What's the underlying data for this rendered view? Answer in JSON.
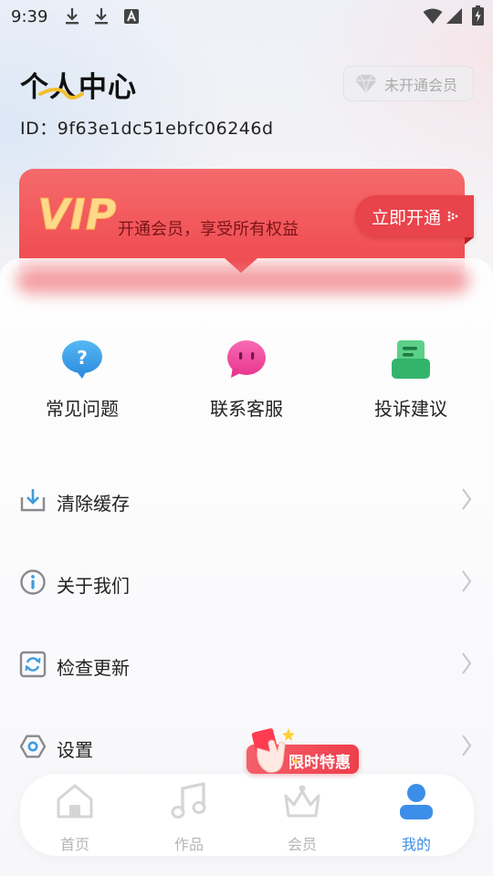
{
  "status_bar": {
    "time": "9:39"
  },
  "header": {
    "title": "个人中心",
    "user_id": "ID：9f63e1dc51ebfc06246d",
    "member_status": "未开通会员"
  },
  "vip": {
    "logo": "VIP",
    "description": "开通会员，享受所有权益",
    "cta": "立即开通"
  },
  "quick_actions": [
    {
      "label": "常见问题",
      "icon": "question-chat-icon"
    },
    {
      "label": "联系客服",
      "icon": "customer-service-icon"
    },
    {
      "label": "投诉建议",
      "icon": "feedback-box-icon"
    }
  ],
  "menu": [
    {
      "label": "清除缓存",
      "icon": "download-tray-icon"
    },
    {
      "label": "关于我们",
      "icon": "info-icon"
    },
    {
      "label": "检查更新",
      "icon": "refresh-icon"
    },
    {
      "label": "设置",
      "icon": "settings-icon"
    }
  ],
  "promo": {
    "label": "限时特惠"
  },
  "nav": [
    {
      "label": "首页",
      "icon": "home-icon"
    },
    {
      "label": "作品",
      "icon": "music-note-icon"
    },
    {
      "label": "会员",
      "icon": "crown-icon"
    },
    {
      "label": "我的",
      "icon": "user-icon",
      "active": true
    }
  ],
  "colors": {
    "vip_red": "#ef4a4f",
    "vip_gold": "#ffd98a",
    "nav_active": "#3d8ee8",
    "nav_inactive": "#b5b5b8"
  }
}
